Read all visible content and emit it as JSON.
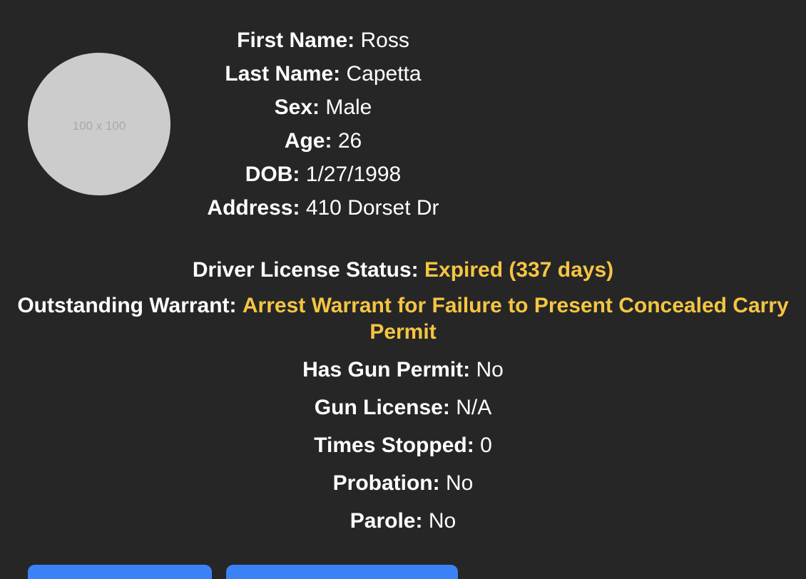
{
  "avatar": {
    "placeholder": "100 x 100"
  },
  "identity": {
    "first_name": {
      "label": "First Name:",
      "value": "Ross"
    },
    "last_name": {
      "label": "Last Name:",
      "value": "Capetta"
    },
    "sex": {
      "label": "Sex:",
      "value": "Male"
    },
    "age": {
      "label": "Age:",
      "value": "26"
    },
    "dob": {
      "label": "DOB:",
      "value": "1/27/1998"
    },
    "address": {
      "label": "Address:",
      "value": "410 Dorset Dr"
    }
  },
  "details": {
    "license": {
      "label": "Driver License Status:",
      "value": "Expired (337 days)"
    },
    "warrant": {
      "label": "Outstanding Warrant:",
      "value": "Arrest Warrant for Failure to Present Concealed Carry Permit"
    },
    "gun_permit": {
      "label": "Has Gun Permit:",
      "value": "No"
    },
    "gun_license": {
      "label": "Gun License:",
      "value": "N/A"
    },
    "times_stopped": {
      "label": "Times Stopped:",
      "value": "0"
    },
    "probation": {
      "label": "Probation:",
      "value": "No"
    },
    "parole": {
      "label": "Parole:",
      "value": "No"
    }
  },
  "colors": {
    "background": "#262626",
    "text": "#ffffff",
    "warning": "#f5c542",
    "button": "#3b82f6",
    "avatar": "#cccccc"
  }
}
